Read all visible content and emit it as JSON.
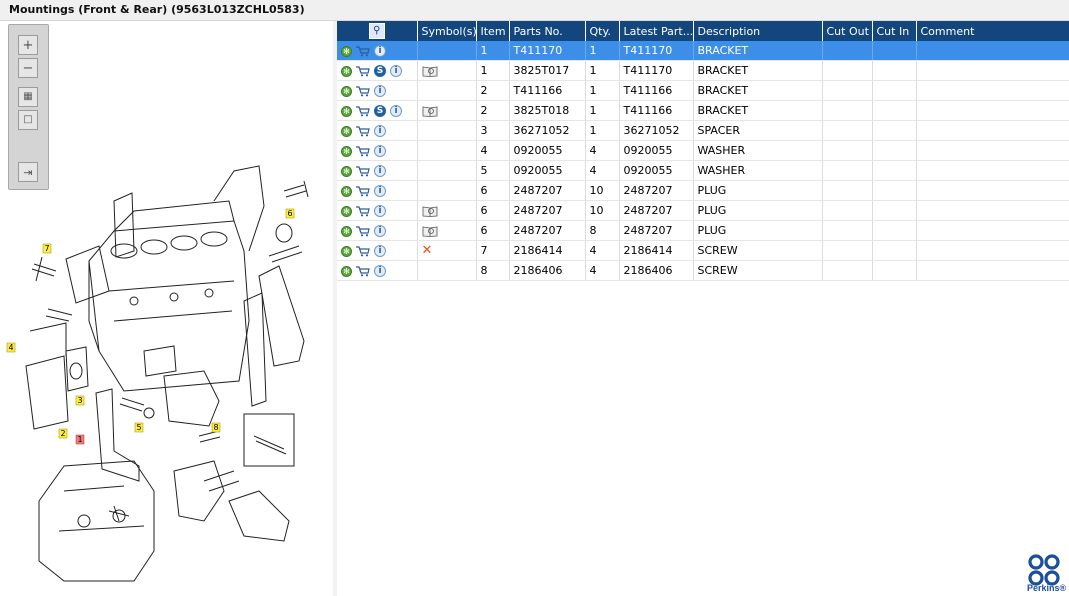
{
  "title": "Mountings (Front & Rear) (9563L013ZCHL0583)",
  "columns": [
    "",
    "Symbol(s)",
    "Item",
    "Parts No.",
    "Qty.",
    "Latest Part...",
    "Description",
    "Cut Out",
    "Cut In",
    "Comment"
  ],
  "rows": [
    {
      "item": "1",
      "part": "T411170",
      "qty": "1",
      "latest": "T411170",
      "desc": "BRACKET",
      "s": false,
      "book": false,
      "x": false
    },
    {
      "item": "1",
      "part": "3825T017",
      "qty": "1",
      "latest": "T411170",
      "desc": "BRACKET",
      "s": true,
      "book": true,
      "x": false
    },
    {
      "item": "2",
      "part": "T411166",
      "qty": "1",
      "latest": "T411166",
      "desc": "BRACKET",
      "s": false,
      "book": false,
      "x": false
    },
    {
      "item": "2",
      "part": "3825T018",
      "qty": "1",
      "latest": "T411166",
      "desc": "BRACKET",
      "s": true,
      "book": true,
      "x": false
    },
    {
      "item": "3",
      "part": "36271052",
      "qty": "1",
      "latest": "36271052",
      "desc": "SPACER",
      "s": false,
      "book": false,
      "x": false
    },
    {
      "item": "4",
      "part": "0920055",
      "qty": "4",
      "latest": "0920055",
      "desc": "WASHER",
      "s": false,
      "book": false,
      "x": false
    },
    {
      "item": "5",
      "part": "0920055",
      "qty": "4",
      "latest": "0920055",
      "desc": "WASHER",
      "s": false,
      "book": false,
      "x": false
    },
    {
      "item": "6",
      "part": "2487207",
      "qty": "10",
      "latest": "2487207",
      "desc": "PLUG",
      "s": false,
      "book": false,
      "x": false
    },
    {
      "item": "6",
      "part": "2487207",
      "qty": "10",
      "latest": "2487207",
      "desc": "PLUG",
      "s": false,
      "book": true,
      "x": false
    },
    {
      "item": "6",
      "part": "2487207",
      "qty": "8",
      "latest": "2487207",
      "desc": "PLUG",
      "s": false,
      "book": true,
      "x": false
    },
    {
      "item": "7",
      "part": "2186414",
      "qty": "4",
      "latest": "2186414",
      "desc": "SCREW",
      "s": false,
      "book": false,
      "x": true
    },
    {
      "item": "8",
      "part": "2186406",
      "qty": "4",
      "latest": "2186406",
      "desc": "SCREW",
      "s": false,
      "book": false,
      "x": false
    }
  ],
  "callouts": [
    "1",
    "2",
    "3",
    "4",
    "5",
    "6",
    "7",
    "8"
  ],
  "brand": "Perkins®",
  "colors": {
    "header": "#14467e",
    "selected": "#3d8ee8",
    "callout": "#ffef3a",
    "callout_selected": "#f07a7a",
    "brand": "#1b4e9b"
  }
}
